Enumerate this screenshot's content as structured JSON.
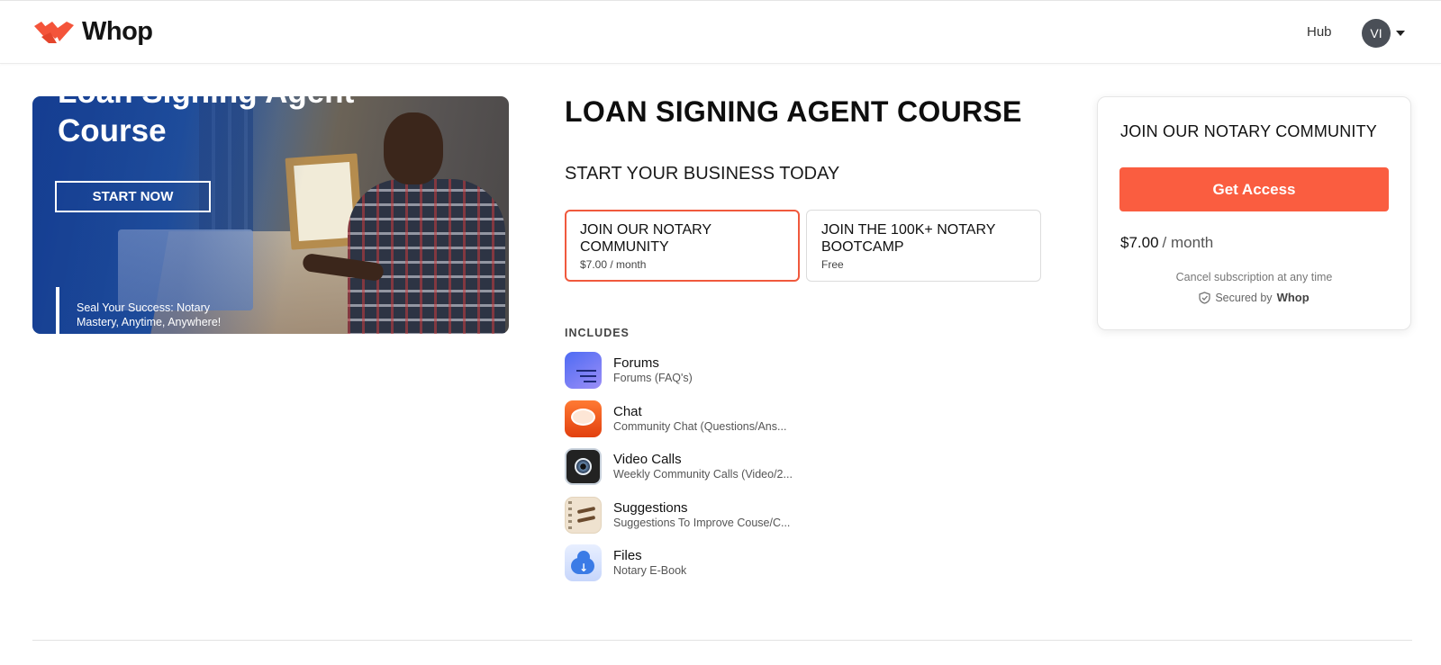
{
  "header": {
    "brand": "Whop",
    "hub_label": "Hub",
    "avatar_initials": "VI"
  },
  "hero": {
    "title_line1": "Loan Signing Agent",
    "title_line2": "Course",
    "cta_label": "START NOW",
    "tagline": "Seal Your Success: Notary Mastery, Anytime, Anywhere!"
  },
  "product": {
    "title": "LOAN SIGNING AGENT COURSE",
    "subtitle": "START YOUR BUSINESS TODAY",
    "plans": [
      {
        "name": "JOIN OUR NOTARY COMMUNITY",
        "price": "$7.00 / month",
        "selected": true
      },
      {
        "name": "JOIN THE 100K+ NOTARY BOOTCAMP",
        "price": "Free",
        "selected": false
      }
    ],
    "includes_label": "INCLUDES",
    "includes": [
      {
        "name": "Forums",
        "desc": "Forums (FAQ's)",
        "icon": "forums-icon"
      },
      {
        "name": "Chat",
        "desc": "Community Chat (Questions/Ans...",
        "icon": "chat-icon"
      },
      {
        "name": "Video Calls",
        "desc": "Weekly Community Calls (Video/2...",
        "icon": "video-calls-icon"
      },
      {
        "name": "Suggestions",
        "desc": "Suggestions To Improve Couse/C...",
        "icon": "suggestions-icon"
      },
      {
        "name": "Files",
        "desc": "Notary E-Book",
        "icon": "files-icon"
      }
    ]
  },
  "checkout": {
    "title": "JOIN OUR NOTARY COMMUNITY",
    "button_label": "Get Access",
    "price": "$7.00",
    "period": "/ month",
    "cancel_note": "Cancel subscription at any time",
    "secured_label": "Secured by",
    "secured_brand": "Whop"
  },
  "colors": {
    "accent": "#fa5d40",
    "selected_border": "#f0593d"
  }
}
